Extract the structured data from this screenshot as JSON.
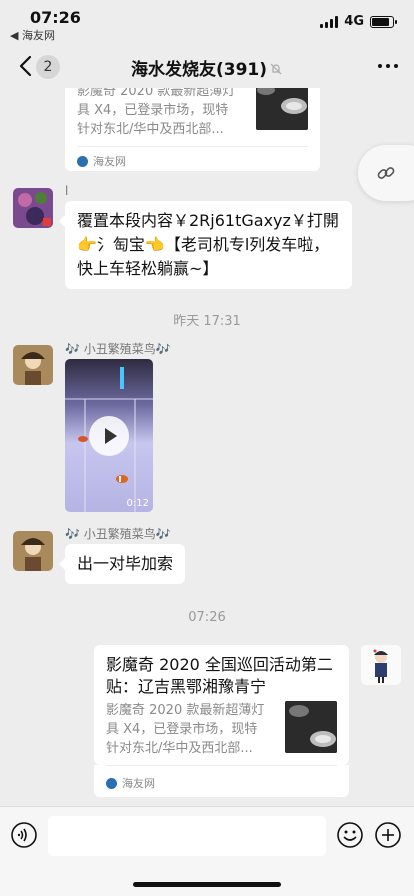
{
  "status_bar": {
    "time": "07:26",
    "back_app": "◀ 海友网",
    "network": "4G"
  },
  "nav": {
    "unread_count": "2",
    "title": "海水发烧友(391)"
  },
  "messages": {
    "top_card": {
      "desc_line1": "影魔奇 2020 款最新超薄灯",
      "desc_line2": "具 X4，已登录市场，现特",
      "desc_line3": "针对东北/华中及西北部...",
      "source": "海友网"
    },
    "taobao": {
      "sender": "l",
      "text": "覆置本段内容￥2Rj61tGaxyz￥打開👉氵匋宝👈【老司机专l列发车啦，快上车轻松躺赢~】"
    },
    "timestamp_1": "昨天 17:31",
    "video_msg": {
      "sender": "🎶 小丑繁殖菜鸟🎶",
      "duration": "0:12"
    },
    "text_msg": {
      "sender": "🎶 小丑繁殖菜鸟🎶",
      "text": "出一对毕加索"
    },
    "timestamp_2": "07:26",
    "bottom_card": {
      "title": "影魔奇 2020 全国巡回活动第二贴：辽吉黑鄂湘豫青宁",
      "desc_line1": "影魔奇 2020 款最新超薄灯",
      "desc_line2": "具 X4，已登录市场，现特",
      "desc_line3": "针对东北/华中及西北部...",
      "source": "海友网"
    }
  },
  "input_bar": {
    "placeholder": ""
  },
  "colors": {
    "background": "#ededed",
    "bubble": "#ffffff",
    "source_icon": "#2a6fb0"
  }
}
